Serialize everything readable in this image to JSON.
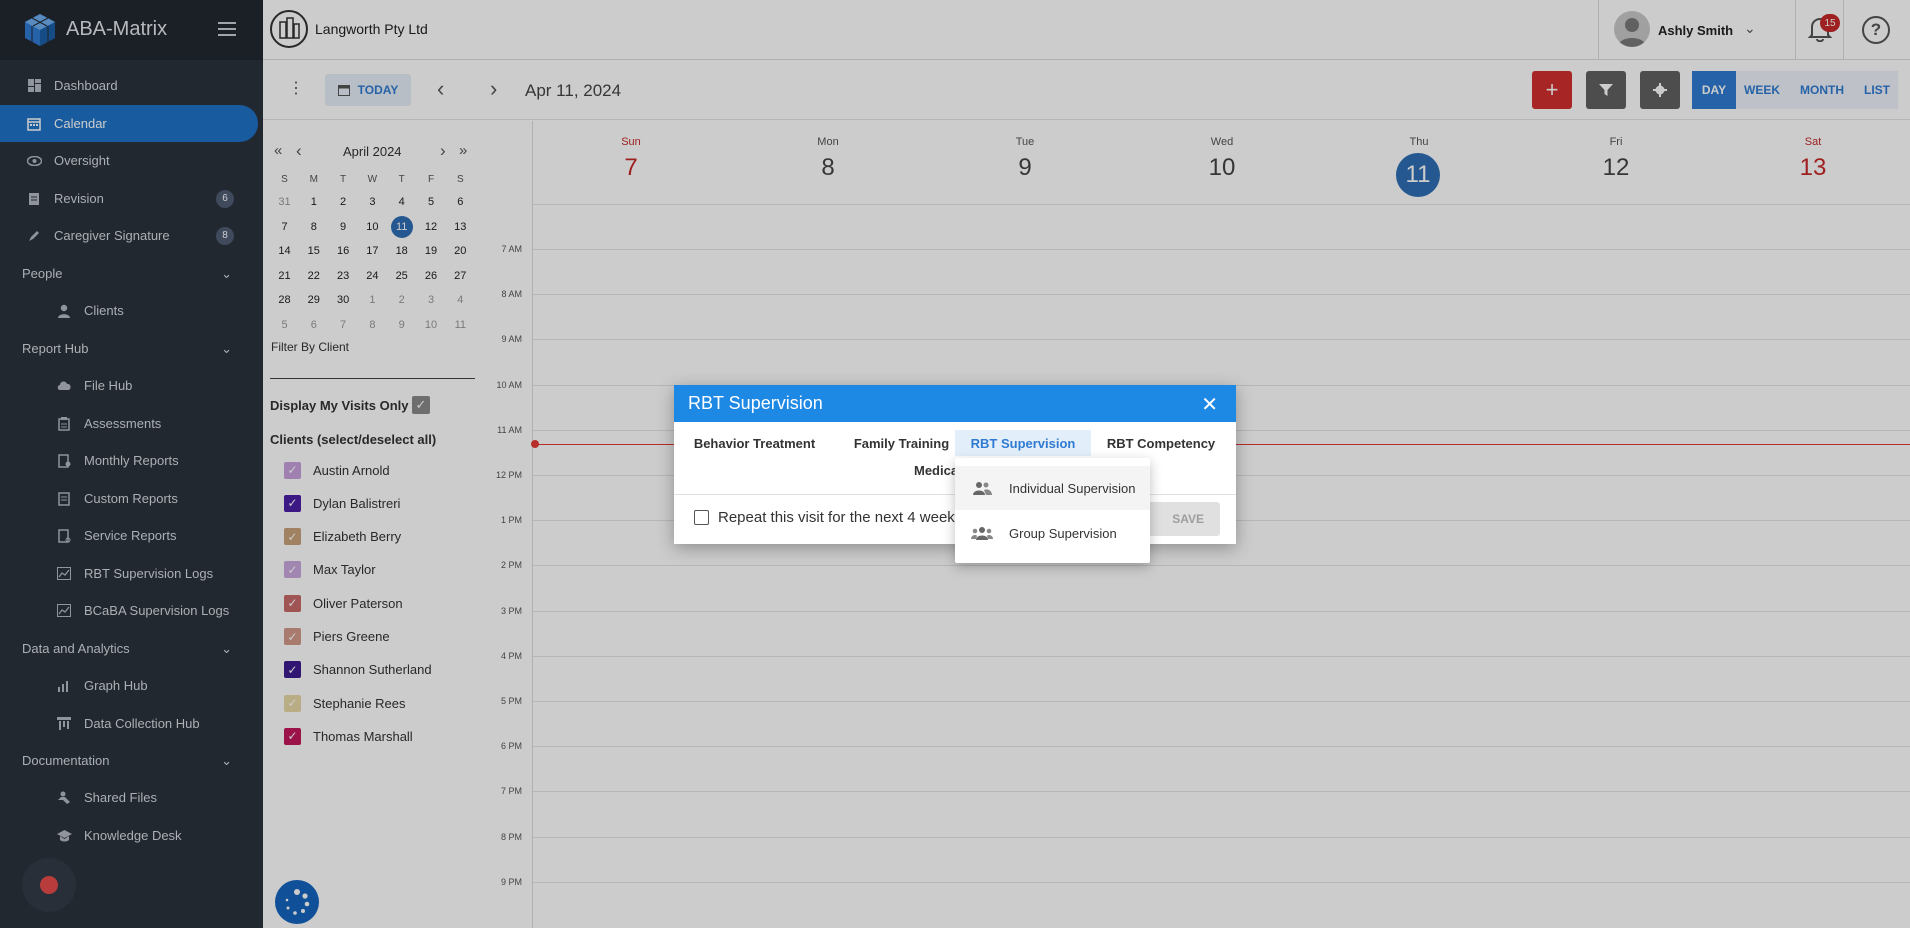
{
  "app": {
    "name": "ABA-Matrix"
  },
  "sidebar": {
    "items": [
      {
        "label": "Dashboard",
        "icon": "dashboard-icon"
      },
      {
        "label": "Calendar",
        "icon": "calendar-icon",
        "active": true
      },
      {
        "label": "Oversight",
        "icon": "eye-icon"
      },
      {
        "label": "Revision",
        "icon": "document-icon",
        "badge": "6"
      },
      {
        "label": "Caregiver Signature",
        "icon": "pen-icon",
        "badge": "8"
      }
    ],
    "sections": [
      {
        "label": "People",
        "items": [
          {
            "label": "Clients",
            "icon": "user-icon"
          }
        ]
      },
      {
        "label": "Report Hub",
        "items": [
          {
            "label": "File Hub",
            "icon": "cloud-icon"
          },
          {
            "label": "Assessments",
            "icon": "clipboard-icon"
          },
          {
            "label": "Monthly Reports",
            "icon": "report-icon"
          },
          {
            "label": "Custom Reports",
            "icon": "report-icon"
          },
          {
            "label": "Service Reports",
            "icon": "report-icon"
          },
          {
            "label": "RBT Supervision Logs",
            "icon": "chart-icon"
          },
          {
            "label": "BCaBA Supervision Logs",
            "icon": "chart-icon"
          }
        ]
      },
      {
        "label": "Data and Analytics",
        "items": [
          {
            "label": "Graph Hub",
            "icon": "bar-chart-icon"
          },
          {
            "label": "Data Collection Hub",
            "icon": "data-icon"
          }
        ]
      },
      {
        "label": "Documentation",
        "items": [
          {
            "label": "Shared Files",
            "icon": "share-icon"
          },
          {
            "label": "Knowledge Desk",
            "icon": "graduation-icon"
          }
        ]
      }
    ]
  },
  "topbar": {
    "company": "Langworth Pty Ltd",
    "user": "Ashly Smith",
    "notifications": "15",
    "help": "?"
  },
  "toolbar": {
    "today": "TODAY",
    "date": "Apr 11, 2024",
    "views": [
      "DAY",
      "WEEK",
      "MONTH",
      "LIST"
    ],
    "active_view": "DAY"
  },
  "mini_calendar": {
    "month": "April 2024",
    "dow": [
      "S",
      "M",
      "T",
      "W",
      "T",
      "F",
      "S"
    ],
    "weeks": [
      [
        "31",
        "1",
        "2",
        "3",
        "4",
        "5",
        "6"
      ],
      [
        "7",
        "8",
        "9",
        "10",
        "11",
        "12",
        "13"
      ],
      [
        "14",
        "15",
        "16",
        "17",
        "18",
        "19",
        "20"
      ],
      [
        "21",
        "22",
        "23",
        "24",
        "25",
        "26",
        "27"
      ],
      [
        "28",
        "29",
        "30",
        "1",
        "2",
        "3",
        "4"
      ],
      [
        "5",
        "6",
        "7",
        "8",
        "9",
        "10",
        "11"
      ]
    ],
    "selected": "11"
  },
  "filters": {
    "filter_by_client": "Filter By Client",
    "display_my_visits": "Display My Visits Only",
    "clients_heading": "Clients (select/deselect all)",
    "clients": [
      {
        "name": "Austin Arnold",
        "color": "#c9a0dc"
      },
      {
        "name": "Dylan Balistreri",
        "color": "#4a1fa6"
      },
      {
        "name": "Elizabeth Berry",
        "color": "#c8a27a"
      },
      {
        "name": "Max Taylor",
        "color": "#c9a8dc"
      },
      {
        "name": "Oliver Paterson",
        "color": "#c86a6a"
      },
      {
        "name": "Piers Greene",
        "color": "#d39a8a"
      },
      {
        "name": "Shannon Sutherland",
        "color": "#3d1c8f"
      },
      {
        "name": "Stephanie Rees",
        "color": "#e8d9a8"
      },
      {
        "name": "Thomas Marshall",
        "color": "#c2185b"
      }
    ]
  },
  "calendar": {
    "days": [
      {
        "name": "Sun",
        "date": "7",
        "weekend": true
      },
      {
        "name": "Mon",
        "date": "8"
      },
      {
        "name": "Tue",
        "date": "9"
      },
      {
        "name": "Wed",
        "date": "10"
      },
      {
        "name": "Thu",
        "date": "11",
        "today": true
      },
      {
        "name": "Fri",
        "date": "12"
      },
      {
        "name": "Sat",
        "date": "13",
        "weekend": true
      }
    ],
    "hours": [
      "7 AM",
      "8 AM",
      "9 AM",
      "10 AM",
      "11 AM",
      "12 PM",
      "1 PM",
      "2 PM",
      "3 PM",
      "4 PM",
      "5 PM",
      "6 PM",
      "7 PM",
      "8 PM",
      "9 PM"
    ]
  },
  "modal": {
    "title": "RBT Supervision",
    "tabs": [
      "Behavior Treatment",
      "Family Training",
      "RBT Supervision",
      "RBT Competency"
    ],
    "tab_second_row": "Medica",
    "repeat_label": "Repeat this visit for the next 4 weeks",
    "save": "SAVE"
  },
  "dropdown": {
    "items": [
      {
        "label": "Individual Supervision",
        "icon": "two-users-icon"
      },
      {
        "label": "Group Supervision",
        "icon": "group-icon"
      }
    ]
  }
}
